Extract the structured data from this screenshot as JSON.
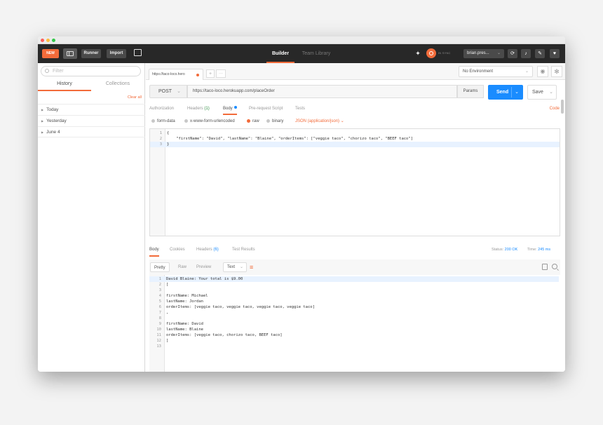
{
  "header": {
    "new_label": "NEW",
    "runner_label": "Runner",
    "import_label": "Import",
    "builder_tab": "Builder",
    "team_library_tab": "Team Library",
    "sync_label": "IN SYNC",
    "user_label": "brian.pres...",
    "icons": [
      "satellite-icon",
      "sync-icon",
      "bell-icon",
      "wrench-icon",
      "heart-icon"
    ]
  },
  "sidebar": {
    "filter_placeholder": "Filter",
    "tabs": [
      "History",
      "Collections"
    ],
    "clear_all": "Clear all",
    "items": [
      {
        "label": "Today"
      },
      {
        "label": "Yesterday"
      },
      {
        "label": "June 4"
      }
    ]
  },
  "tabbar": {
    "active_tab": "https://taco-loco.hero",
    "add_label": "+",
    "more_label": "···",
    "environment": "No Environment"
  },
  "request": {
    "method": "POST",
    "url": "https://taco-loco.herokuapp.com/placeOrder",
    "params_label": "Params",
    "send_label": "Send",
    "save_label": "Save"
  },
  "subtabs": {
    "authorization": "Authorization",
    "headers": "Headers",
    "headers_count": "(1)",
    "body": "Body",
    "prerequest": "Pre-request Script",
    "tests": "Tests",
    "code": "Code"
  },
  "body_options": {
    "form_data": "form-data",
    "urlencoded": "x-www-form-urlencoded",
    "raw": "raw",
    "binary": "binary",
    "json_type": "JSON (application/json)"
  },
  "editor": {
    "lines": [
      {
        "n": "1",
        "text": "{"
      },
      {
        "n": "2",
        "text": "    \"firstName\": \"David\", \"lastName\": \"Blaine\", \"orderItems\": [\"veggie taco\", \"chorizo taco\", \"BEEF taco\"]"
      },
      {
        "n": "3",
        "text": "}"
      }
    ]
  },
  "response_tabs": {
    "body": "Body",
    "cookies": "Cookies",
    "headers": "Headers",
    "headers_count": "(6)",
    "test_results": "Test Results",
    "status_label": "Status:",
    "status_value": "200 OK",
    "time_label": "Time:",
    "time_value": "245 ms"
  },
  "response_format": {
    "pretty": "Pretty",
    "raw": "Raw",
    "preview": "Preview",
    "text_type": "Text"
  },
  "response": {
    "lines": [
      {
        "n": "1",
        "text": "David Blaine: Your total is $9.00"
      },
      {
        "n": "2",
        "text": "["
      },
      {
        "n": "3",
        "text": ""
      },
      {
        "n": "4",
        "text": "firstName: Michael"
      },
      {
        "n": "5",
        "text": "lastName: Jordan"
      },
      {
        "n": "6",
        "text": "orderItems: [veggie taco, veggie taco, veggie taco, veggie taco]"
      },
      {
        "n": "7",
        "text": ","
      },
      {
        "n": "8",
        "text": ""
      },
      {
        "n": "9",
        "text": "firstName: David"
      },
      {
        "n": "10",
        "text": "lastName: Blaine"
      },
      {
        "n": "11",
        "text": "orderItems: [veggie taco, chorizo taco, BEEF taco]"
      },
      {
        "n": "12",
        "text": "]"
      },
      {
        "n": "13",
        "text": ""
      }
    ]
  },
  "colors": {
    "accent": "#f26b3a",
    "primary": "#1a8cff",
    "header_bg": "#282828"
  }
}
